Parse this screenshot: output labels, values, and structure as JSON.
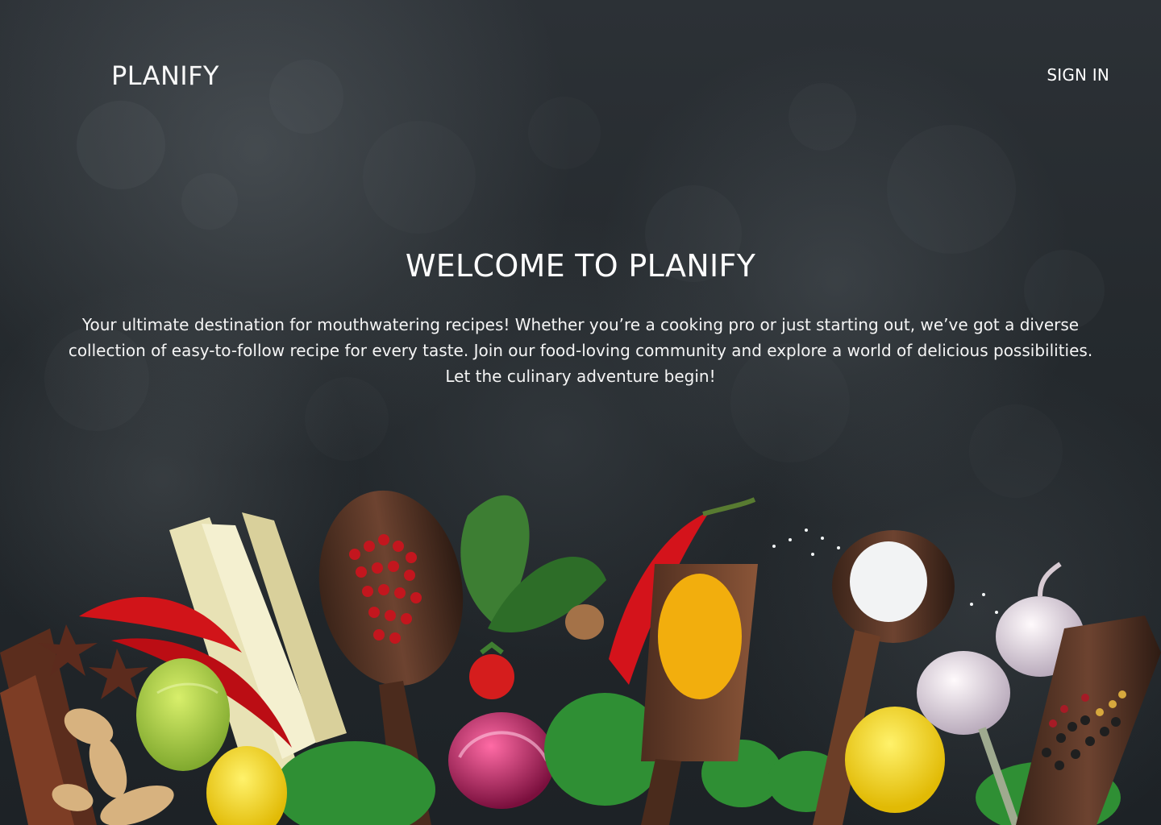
{
  "header": {
    "brand": "PLANIFY",
    "sign_in": "SIGN IN"
  },
  "hero": {
    "title": "WELCOME TO PLANIFY",
    "lines": [
      "Your ultimate destination for mouthwatering recipes! Whether you’re a cooking pro or just starting out, we’ve got a diverse",
      "collection of easy-to-follow recipe for every taste. Join our food-loving community and explore a world of delicious possibilities.",
      "Let the culinary adventure  begin!"
    ]
  },
  "theme": {
    "background": "#252a2e",
    "text": "#ffffff"
  }
}
